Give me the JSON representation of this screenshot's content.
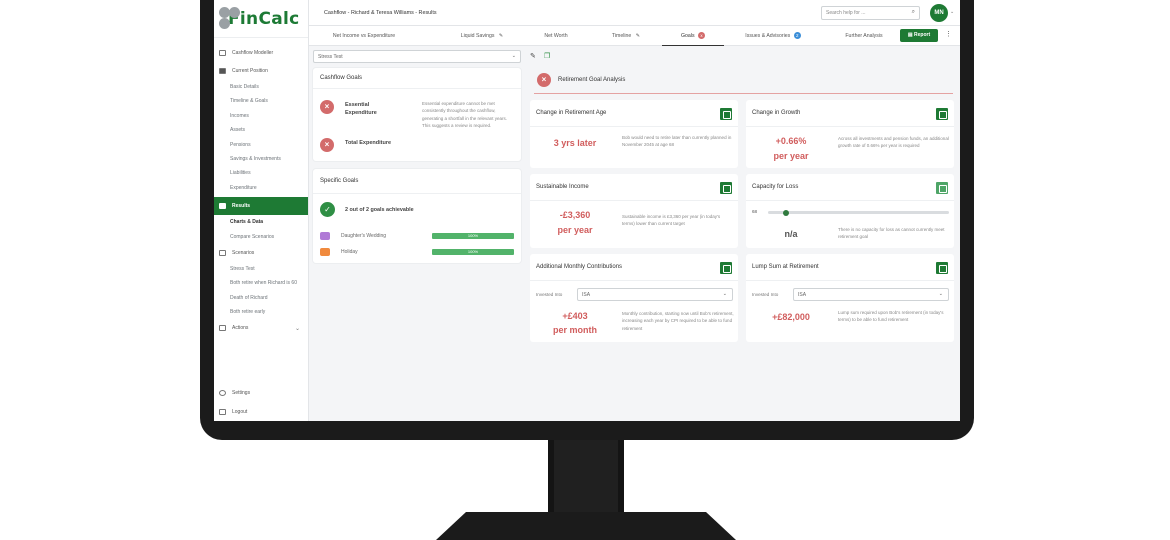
{
  "app": {
    "logo_text": "FinCalc",
    "breadcrumb": "Cashflow - Richard & Teresa Williams - Results",
    "search_placeholder": "Search help for ...",
    "avatar_initials": "MN",
    "colors": {
      "brand_green": "#1e7a34",
      "alert_red": "#d36b6b",
      "progress_green": "#52b36a"
    }
  },
  "sidebar": {
    "top": {
      "icon": "cashflow-icon",
      "label": "Cashflow Modeller"
    },
    "current_position": {
      "label": "Current Position",
      "items": [
        "Basic Details",
        "Timeline & Goals",
        "Incomes",
        "Assets",
        "Pensions",
        "Savings & Investments",
        "Liabilities",
        "Expenditure"
      ]
    },
    "results": {
      "label": "Results",
      "items": [
        "Charts & Data",
        "Compare Scenarios"
      ]
    },
    "scenarios": {
      "label": "Scenarios",
      "items": [
        "Stress Test",
        "Both retire when Richard is 60",
        "Death of Richard",
        "Both retire early"
      ]
    },
    "actions": {
      "label": "Actions"
    },
    "settings": "Settings",
    "logout": "Logout"
  },
  "tabs": [
    {
      "label": "Net Income vs Expenditure"
    },
    {
      "label": "Liquid Savings",
      "icon": "pin-icon"
    },
    {
      "label": "Net Worth"
    },
    {
      "label": "Timeline",
      "icon": "pin-icon"
    },
    {
      "label": "Goals",
      "badge": "x",
      "active": true
    },
    {
      "label": "Issues & Advisories",
      "badge": "2"
    },
    {
      "label": "Further Analysis"
    }
  ],
  "report_button": "Report",
  "scenario_select": {
    "value": "Stress Test"
  },
  "cashflow_goals": {
    "title": "Cashflow Goals",
    "items": [
      "Essential Expenditure",
      "Total Expenditure"
    ],
    "note": "Essential expenditure cannot be met consistently throughout the cashflow, generating a shortfall in the relevant years. This suggests a review is required."
  },
  "specific_goals": {
    "title": "Specific Goals",
    "summary": "2 out of 2 goals achievable",
    "goals": [
      {
        "name": "Daughter's Wedding",
        "percent": 100,
        "label": "100%",
        "color": "#b07ad6"
      },
      {
        "name": "Holiday",
        "percent": 100,
        "label": "100%",
        "color": "#f08a3e"
      }
    ]
  },
  "analysis": {
    "title": "Retirement Goal Analysis",
    "retirement_age": {
      "title": "Change in Retirement Age",
      "value": "3 yrs later",
      "desc": "Bob would need to retire later than currently planned in November 2045 at age 68"
    },
    "growth": {
      "title": "Change in Growth",
      "value_line1": "+0.66%",
      "value_line2": "per year",
      "desc": "Across all investments and pension funds, an additional growth rate of 0.66% per year is required"
    },
    "income": {
      "title": "Sustainable Income",
      "value_line1": "-£3,360",
      "value_line2": "per year",
      "desc": "Sustainable income is £3,360 per year (in today's terms) lower than current target"
    },
    "capacity": {
      "title": "Capacity for Loss",
      "slider_label": "68",
      "slider_level": 0.1,
      "value": "n/a",
      "desc": "There is no capacity for loss as cannot currently meet retirement goal"
    },
    "contributions": {
      "title": "Additional Monthly Contributions",
      "invest_label": "Invested Into",
      "invest_value": "ISA",
      "value_line1": "+£403",
      "value_line2": "per month",
      "desc": "Monthly contribution, starting now until Bob's retirement, increasing each year by CPI required to be able to fund retirement"
    },
    "lump_sum": {
      "title": "Lump Sum at Retirement",
      "invest_label": "Invested Into",
      "invest_value": "ISA",
      "value": "+£82,000",
      "desc": "Lump sum required upon Bob's retirement (in today's terms) to be able to fund retirement"
    }
  }
}
